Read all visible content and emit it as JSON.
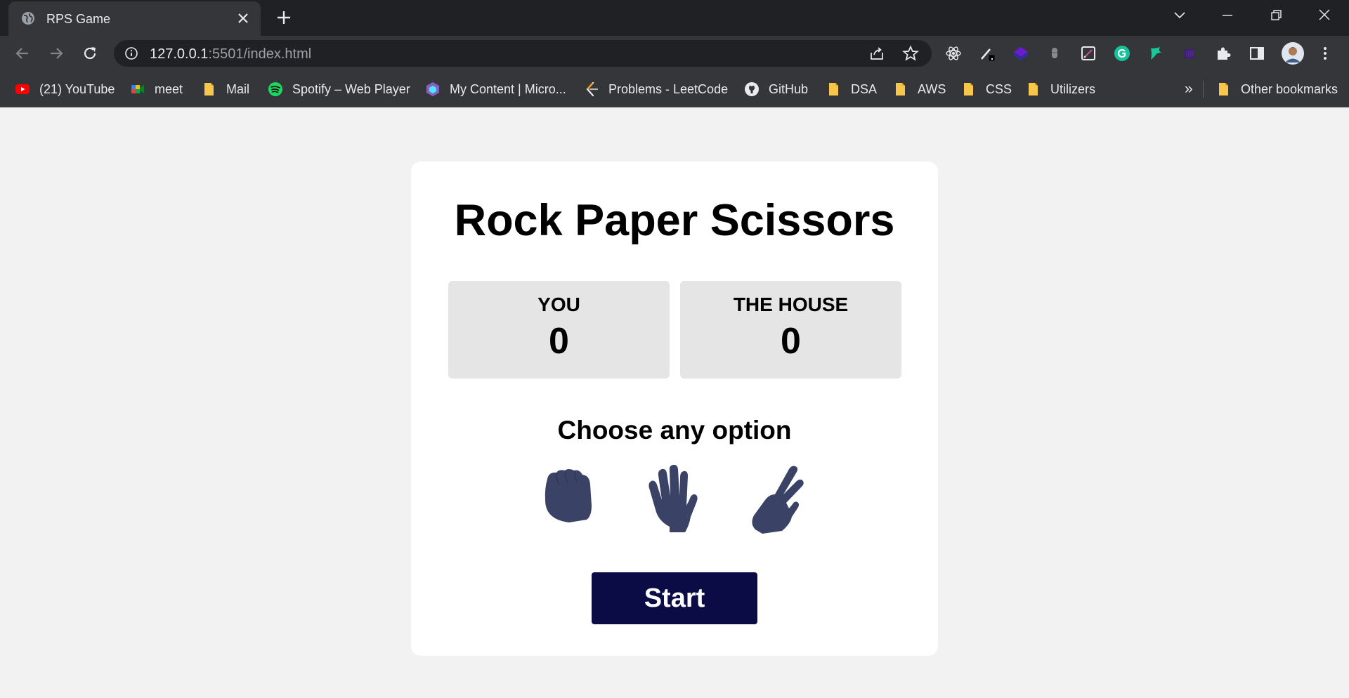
{
  "browser": {
    "tab": {
      "title": "RPS Game"
    },
    "address": {
      "host": "127.0.0.1",
      "rest": ":5501/index.html"
    },
    "bookmarks": [
      {
        "label": "(21) YouTube",
        "icon": "youtube-icon"
      },
      {
        "label": "meet",
        "icon": "meet-icon"
      },
      {
        "label": "Mail",
        "icon": "folder-icon"
      },
      {
        "label": "Spotify – Web Player",
        "icon": "spotify-icon"
      },
      {
        "label": "My Content | Micro...",
        "icon": "microsoft-learn-icon"
      },
      {
        "label": "Problems - LeetCode",
        "icon": "leetcode-icon"
      },
      {
        "label": "GitHub",
        "icon": "github-icon"
      },
      {
        "label": "DSA",
        "icon": "folder-icon"
      },
      {
        "label": "AWS",
        "icon": "folder-icon"
      },
      {
        "label": "CSS",
        "icon": "folder-icon"
      },
      {
        "label": "Utilizers",
        "icon": "folder-icon"
      }
    ],
    "more_bookmarks": "»",
    "other_bookmarks": "Other bookmarks"
  },
  "game": {
    "title": "Rock Paper Scissors",
    "scores": [
      {
        "label": "YOU",
        "value": "0"
      },
      {
        "label": "THE HOUSE",
        "value": "0"
      }
    ],
    "prompt": "Choose any option",
    "options": [
      "rock-icon",
      "paper-icon",
      "scissors-icon"
    ],
    "start_label": "Start"
  },
  "colors": {
    "page_bg": "#f2f2f2",
    "card_bg": "#ffffff",
    "score_bg": "#e5e5e5",
    "hand_color": "#3a4266",
    "button_bg": "#0b0b45",
    "chrome_dark": "#202124",
    "chrome_mid": "#35363a"
  }
}
